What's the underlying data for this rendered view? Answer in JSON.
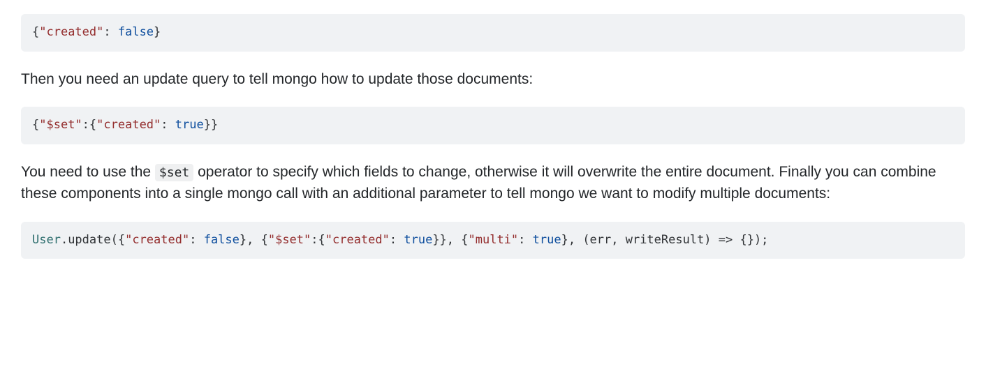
{
  "code1": {
    "created_key": "\"created\"",
    "false_val": "false"
  },
  "para1": "Then you need an update query to tell mongo how to update those documents:",
  "code2": {
    "set_key": "\"$set\"",
    "created_key": "\"created\"",
    "true_val": "true"
  },
  "para2_a": "You need to use the ",
  "para2_inline": "$set",
  "para2_b": " operator to specify which fields to change, otherwise it will overwrite the entire document. Finally you can combine these components into a single mongo call with an additional parameter to tell mongo we want to modify multiple documents:",
  "code3": {
    "user_var": "User",
    "update_call": ".update(",
    "created_key1": "\"created\"",
    "false_val": "false",
    "set_key": "\"$set\"",
    "created_key2": "\"created\"",
    "true_val": "true",
    "multi_key": "\"multi\"",
    "true_val2": "true",
    "tail": ", (err, writeResult) => {});"
  }
}
